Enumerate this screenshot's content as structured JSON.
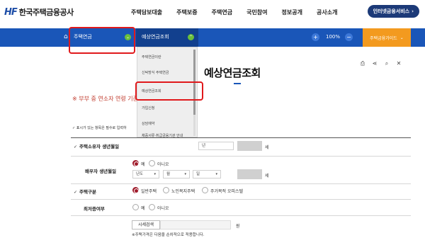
{
  "header": {
    "logo_mark": "HF",
    "logo_text": "한국주택금융공사",
    "menu": [
      "주택담보대출",
      "주택보증",
      "주택연금",
      "국민참여",
      "정보공개",
      "공사소개"
    ],
    "internet_service_label": "인터넷금융서비스",
    "internet_service_arrow": "›"
  },
  "navbar": {
    "home_icon": "⌂",
    "crumb1": "주택연금",
    "crumb1_chevron": "⌄",
    "crumb2": "예상연금조회",
    "crumb2_chevron": "⌃",
    "zoom_in": "+",
    "zoom_level": "100%",
    "zoom_out": "−",
    "guide_label": "주택금융가이드",
    "guide_arrow": "⌄"
  },
  "dropdown": {
    "items": [
      "주택연금이란",
      "신탁방식 주택연금",
      "예상연금조회",
      "가입신청",
      "상담예약",
      "채증서류·취급금융기관 안내"
    ]
  },
  "tools": {
    "print_icon": "⎙",
    "share_icon": "⋖",
    "search_icon": "⌕",
    "close_icon": "✕"
  },
  "page": {
    "title": "예상연금조회",
    "notice": "※ 부부 중 연소자 연령 기준으",
    "required_note": "✓ 표시가 있는 항목은 필수로 입력하"
  },
  "form": {
    "owner_birth_label": "주택소유자 생년월일",
    "owner_birth_select": "년",
    "owner_age_unit": "세",
    "spouse_birth_label": "배우자 생년월일",
    "spouse_yes": "예",
    "spouse_no": "아니오",
    "spouse_year": "년도",
    "spouse_month": "월",
    "spouse_day": "일",
    "spouse_age_unit": "세",
    "housing_type_label": "주택구분",
    "housing_general": "일반주택",
    "housing_senior": "노인복지주택",
    "housing_officetel": "주거목적 오피스텔",
    "lowest_label": "최저증여부",
    "lowest_yes": "예",
    "lowest_no": "아니오",
    "market_button": "시세검색",
    "price_unit": "원",
    "footnote": "※주택가격은 다음을 순차적으로 적용합니다."
  },
  "colors": {
    "nav_blue": "#1a56b8",
    "nav_dark_blue": "#12408e",
    "accent_green": "#6abf3c",
    "guide_orange": "#f39a1f",
    "highlight_red": "#e0191c",
    "notice_red": "#c0392b",
    "radio_selected": "#a01c2c"
  }
}
